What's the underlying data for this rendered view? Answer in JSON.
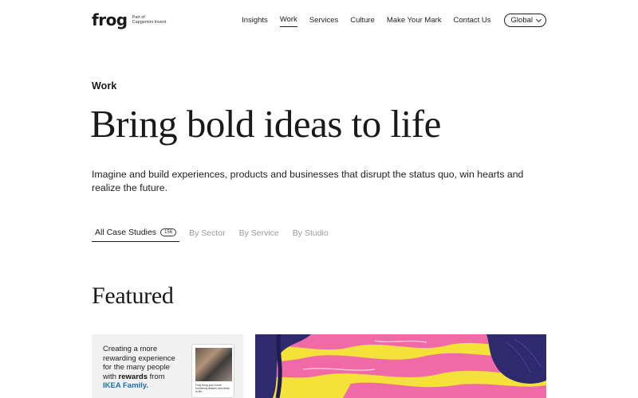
{
  "header": {
    "logo": "frog",
    "logo_sub_line1": "Part of",
    "logo_sub_line2": "Capgemini Invent",
    "nav": [
      {
        "label": "Insights"
      },
      {
        "label": "Work"
      },
      {
        "label": "Services"
      },
      {
        "label": "Culture"
      },
      {
        "label": "Make Your Mark"
      },
      {
        "label": "Contact Us"
      }
    ],
    "active_nav": "Work",
    "region_label": "Global"
  },
  "hero": {
    "eyebrow": "Work",
    "title": "Bring bold ideas to life",
    "intro": "Imagine and build experiences, products and businesses that disrupt the status quo, win hearts and realize the future."
  },
  "tabs": [
    {
      "label": "All Case Studies",
      "count": "156"
    },
    {
      "label": "By Sector"
    },
    {
      "label": "By Service"
    },
    {
      "label": "By Studio"
    }
  ],
  "featured": {
    "heading": "Featured",
    "card1": {
      "text_lead": "Creating a more rewarding experience for the many people with",
      "text_bold": "rewards",
      "text_mid": "from",
      "text_brand": "IKEA Family",
      "text_end": ".",
      "phone_caption": "Fully bring your home furnishing dreams and ideas to life."
    }
  },
  "colors": {
    "accent_blue": "#1b6fb5",
    "art_yellow": "#f4e23a",
    "art_pink": "#f06aa7",
    "art_navy": "#2e2a6e"
  }
}
